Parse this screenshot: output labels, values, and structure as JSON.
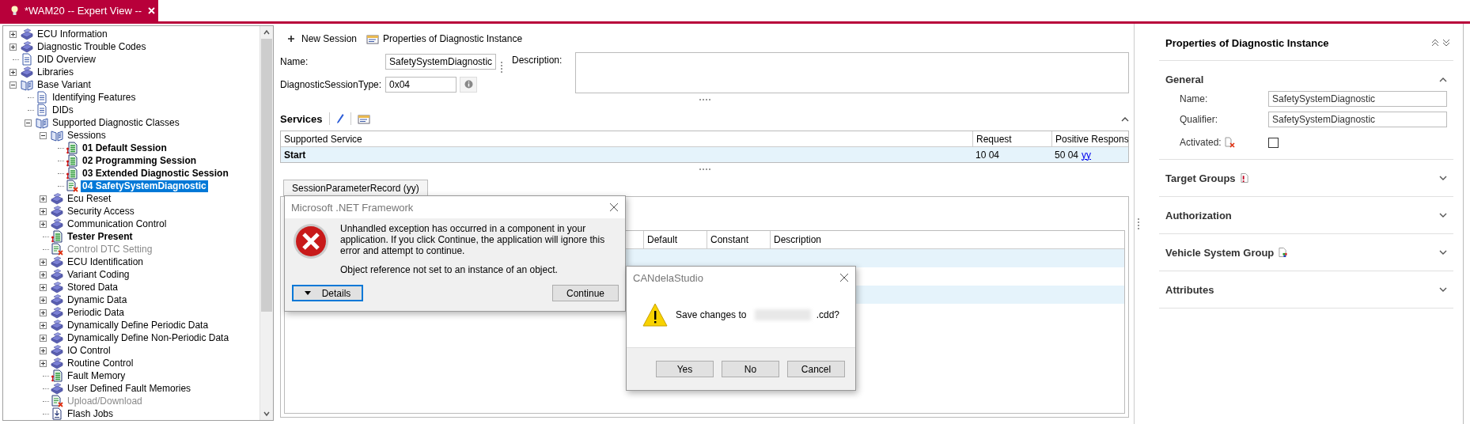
{
  "window": {
    "tab_title": "*WAM20 -- Expert View --"
  },
  "tree": {
    "items": [
      {
        "label": "ECU Information",
        "kind": "class",
        "expanded": false,
        "bold": false,
        "disabled": false,
        "selected": false
      },
      {
        "label": "Diagnostic Trouble Codes",
        "kind": "class",
        "expanded": false,
        "bold": false,
        "disabled": false,
        "selected": false
      },
      {
        "label": "DID Overview",
        "kind": "page",
        "bold": false,
        "disabled": false,
        "selected": false
      },
      {
        "label": "Libraries",
        "kind": "class",
        "expanded": false,
        "bold": false,
        "disabled": false,
        "selected": false
      },
      {
        "label": "Base Variant",
        "kind": "open",
        "expanded": true,
        "bold": false,
        "disabled": false,
        "selected": false,
        "children": [
          {
            "label": "Identifying Features",
            "kind": "page",
            "bold": false,
            "disabled": false,
            "selected": false
          },
          {
            "label": "DIDs",
            "kind": "page",
            "bold": false,
            "disabled": false,
            "selected": false
          },
          {
            "label": "Supported Diagnostic Classes",
            "kind": "open",
            "expanded": true,
            "bold": false,
            "disabled": false,
            "selected": false,
            "children": [
              {
                "label": "Sessions",
                "kind": "open",
                "expanded": true,
                "bold": false,
                "disabled": false,
                "selected": false,
                "children": [
                  {
                    "label": "01 Default Session",
                    "kind": "session",
                    "bold": true,
                    "disabled": false,
                    "selected": false
                  },
                  {
                    "label": "02 Programming Session",
                    "kind": "session",
                    "bold": true,
                    "disabled": false,
                    "selected": false
                  },
                  {
                    "label": "03 Extended Diagnostic Session",
                    "kind": "session",
                    "bold": true,
                    "disabled": false,
                    "selected": false
                  },
                  {
                    "label": "04 SafetySystemDiagnostic",
                    "kind": "inactive",
                    "bold": true,
                    "disabled": false,
                    "selected": true
                  }
                ]
              },
              {
                "label": "Ecu Reset",
                "kind": "class",
                "expanded": false,
                "bold": false,
                "disabled": false,
                "selected": false
              },
              {
                "label": "Security Access",
                "kind": "class",
                "expanded": false,
                "bold": false,
                "disabled": false,
                "selected": false
              },
              {
                "label": "Communication Control",
                "kind": "class",
                "expanded": false,
                "bold": false,
                "disabled": false,
                "selected": false
              },
              {
                "label": "Tester Present",
                "kind": "session",
                "bold": true,
                "disabled": false,
                "selected": false
              },
              {
                "label": "Control DTC Setting",
                "kind": "inactive",
                "bold": false,
                "disabled": true,
                "selected": false
              },
              {
                "label": "ECU Identification",
                "kind": "class",
                "expanded": false,
                "bold": false,
                "disabled": false,
                "selected": false
              },
              {
                "label": "Variant Coding",
                "kind": "class",
                "expanded": false,
                "bold": false,
                "disabled": false,
                "selected": false
              },
              {
                "label": "Stored Data",
                "kind": "class",
                "expanded": false,
                "bold": false,
                "disabled": false,
                "selected": false
              },
              {
                "label": "Dynamic Data",
                "kind": "class",
                "expanded": false,
                "bold": false,
                "disabled": false,
                "selected": false
              },
              {
                "label": "Periodic Data",
                "kind": "class",
                "expanded": false,
                "bold": false,
                "disabled": false,
                "selected": false
              },
              {
                "label": "Dynamically Define Periodic Data",
                "kind": "class",
                "expanded": false,
                "bold": false,
                "disabled": false,
                "selected": false
              },
              {
                "label": "Dynamically Define Non-Periodic Data",
                "kind": "class",
                "expanded": false,
                "bold": false,
                "disabled": false,
                "selected": false
              },
              {
                "label": "IO Control",
                "kind": "class",
                "expanded": false,
                "bold": false,
                "disabled": false,
                "selected": false
              },
              {
                "label": "Routine Control",
                "kind": "class",
                "expanded": false,
                "bold": false,
                "disabled": false,
                "selected": false
              },
              {
                "label": "Fault Memory",
                "kind": "session",
                "bold": false,
                "disabled": false,
                "selected": false
              },
              {
                "label": "User Defined Fault Memories",
                "kind": "class",
                "bold": false,
                "disabled": false,
                "selected": false
              },
              {
                "label": "Upload/Download",
                "kind": "inactive",
                "bold": false,
                "disabled": true,
                "selected": false
              },
              {
                "label": "Flash Jobs",
                "kind": "flash",
                "bold": false,
                "disabled": false,
                "selected": false
              }
            ]
          }
        ]
      }
    ]
  },
  "toolbar": [
    {
      "label": "New Session",
      "kind": "add"
    },
    {
      "label": "Properties of Diagnostic Instance",
      "kind": "properties"
    }
  ],
  "form": {
    "name_label": "Name:",
    "name_value": "SafetySystemDiagnostic",
    "type_label": "DiagnosticSessionType:",
    "type_value": "0x04",
    "description_label": "Description:"
  },
  "services": {
    "title": "Services",
    "expanded": true,
    "columns": [
      "Supported Service",
      "Request",
      "Positive Respons"
    ],
    "rows": [
      {
        "service": "Start",
        "request": "10 04",
        "response": "50 04",
        "response_link": "yy",
        "selected": true
      }
    ]
  },
  "parameters": {
    "tab": "SessionParameterRecord (yy)",
    "columns": [
      "Default",
      "Constant",
      "Description"
    ]
  },
  "error_dialog": {
    "title": "Microsoft .NET Framework",
    "message": "Unhandled exception has occurred in a component in your application. If you click Continue, the application will ignore this error and attempt to continue.",
    "detail": "Object reference not set to an instance of an object.",
    "buttons": [
      {
        "label": "Details",
        "kind": "expander",
        "focused": true
      },
      {
        "label": "Continue",
        "kind": "plain",
        "focused": false
      }
    ]
  },
  "save_dialog": {
    "title": "CANdelaStudio",
    "message_start": "Save changes to",
    "message_end": ".cdd?",
    "buttons": [
      {
        "label": "Yes",
        "focused": false
      },
      {
        "label": "No",
        "focused": false
      },
      {
        "label": "Cancel",
        "focused": false
      }
    ]
  },
  "properties": {
    "title": "Properties of Diagnostic Instance",
    "sections": [
      {
        "title": "General",
        "kind": "plain",
        "expanded": true
      },
      {
        "title": "Target Groups",
        "kind": "error-doc",
        "expanded": false
      },
      {
        "title": "Authorization",
        "kind": "plain",
        "expanded": false
      },
      {
        "title": "Vehicle System Group",
        "kind": "color-doc",
        "expanded": false
      },
      {
        "title": "Attributes",
        "kind": "plain",
        "expanded": false
      }
    ],
    "fields": [
      {
        "label": "Name:",
        "value": "SafetySystemDiagnostic"
      },
      {
        "label": "Qualifier:",
        "value": "SafetySystemDiagnostic"
      }
    ],
    "activated": {
      "label": "Activated:",
      "checked": false
    }
  }
}
